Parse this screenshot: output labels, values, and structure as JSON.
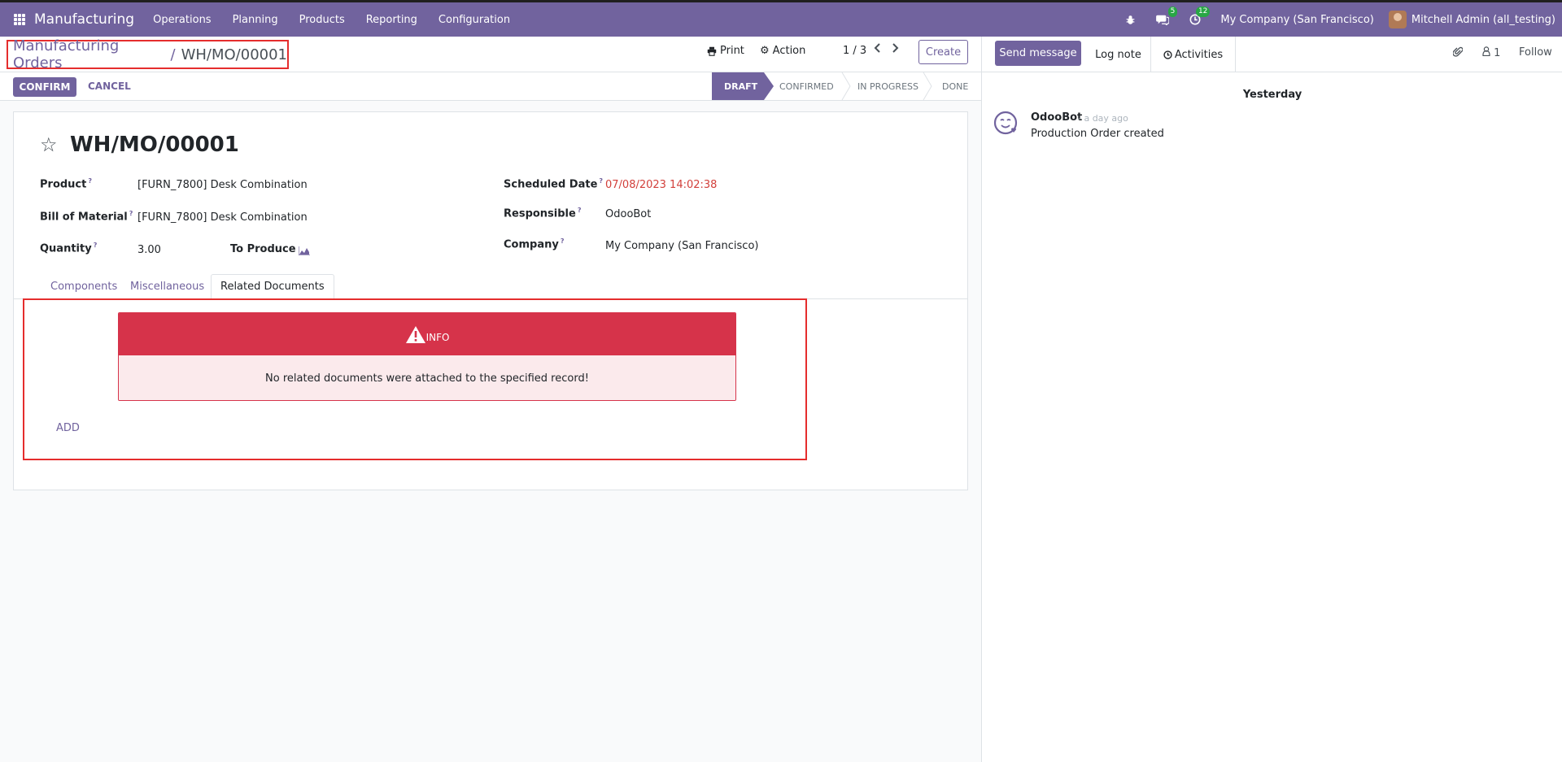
{
  "navbar": {
    "app_name": "Manufacturing",
    "menu": [
      "Operations",
      "Planning",
      "Products",
      "Reporting",
      "Configuration"
    ],
    "messages_count": "5",
    "activities_count": "12",
    "company": "My Company (San Francisco)",
    "user": "Mitchell Admin (all_testing)"
  },
  "control_panel": {
    "breadcrumb_parent": "Manufacturing Orders",
    "breadcrumb_sep": "/",
    "breadcrumb_current": "WH/MO/00001",
    "print_label": "Print",
    "action_label": "Action",
    "pager": "1 / 3",
    "create_label": "Create"
  },
  "statusbar": {
    "confirm_label": "CONFIRM",
    "cancel_label": "CANCEL",
    "stages": [
      "DRAFT",
      "CONFIRMED",
      "IN PROGRESS",
      "DONE"
    ],
    "active_stage": "DRAFT"
  },
  "form": {
    "title": "WH/MO/00001",
    "product_label": "Product",
    "product_value": "[FURN_7800] Desk Combination",
    "bom_label": "Bill of Material",
    "bom_value": "[FURN_7800] Desk Combination",
    "quantity_label": "Quantity",
    "quantity_value": "3.00",
    "to_produce_label": "To Produce",
    "scheduled_label": "Scheduled Date",
    "scheduled_value": "07/08/2023 14:02:38",
    "responsible_label": "Responsible",
    "responsible_value": "OdooBot",
    "company_label": "Company",
    "company_value": "My Company (San Francisco)",
    "help_mark": "?"
  },
  "tabs": [
    "Components",
    "Miscellaneous",
    "Related Documents"
  ],
  "related": {
    "info_title": "INFO",
    "info_message": "No related documents were attached to the specified record!",
    "add_label": "ADD"
  },
  "chatter": {
    "send_message_label": "Send message",
    "log_note_label": "Log note",
    "activities_label": "Activities",
    "followers_count": "1",
    "follow_label": "Follow",
    "date_separator": "Yesterday",
    "message": {
      "author": "OdooBot",
      "time": "- a day ago",
      "body": "Production Order created"
    }
  },
  "colors": {
    "brand": "#71639e",
    "danger": "#d6334a",
    "highlight_outline": "#e52d2d",
    "badge": "#28a745"
  }
}
